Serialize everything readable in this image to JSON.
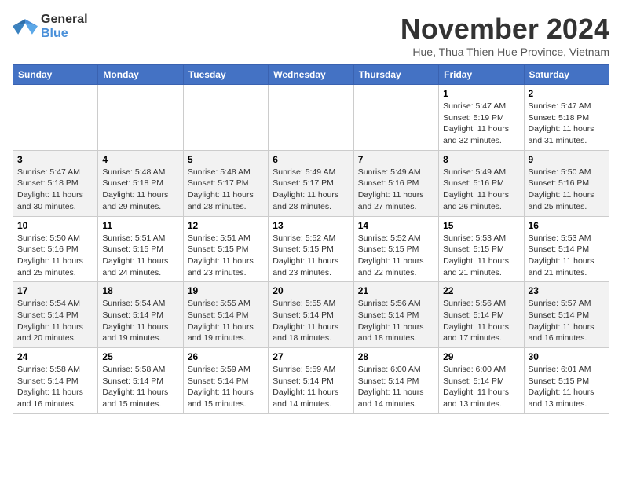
{
  "header": {
    "logo_line1": "General",
    "logo_line2": "Blue",
    "month_title": "November 2024",
    "location": "Hue, Thua Thien Hue Province, Vietnam"
  },
  "weekdays": [
    "Sunday",
    "Monday",
    "Tuesday",
    "Wednesday",
    "Thursday",
    "Friday",
    "Saturday"
  ],
  "weeks": [
    [
      {
        "day": "",
        "info": ""
      },
      {
        "day": "",
        "info": ""
      },
      {
        "day": "",
        "info": ""
      },
      {
        "day": "",
        "info": ""
      },
      {
        "day": "",
        "info": ""
      },
      {
        "day": "1",
        "info": "Sunrise: 5:47 AM\nSunset: 5:19 PM\nDaylight: 11 hours\nand 32 minutes."
      },
      {
        "day": "2",
        "info": "Sunrise: 5:47 AM\nSunset: 5:18 PM\nDaylight: 11 hours\nand 31 minutes."
      }
    ],
    [
      {
        "day": "3",
        "info": "Sunrise: 5:47 AM\nSunset: 5:18 PM\nDaylight: 11 hours\nand 30 minutes."
      },
      {
        "day": "4",
        "info": "Sunrise: 5:48 AM\nSunset: 5:18 PM\nDaylight: 11 hours\nand 29 minutes."
      },
      {
        "day": "5",
        "info": "Sunrise: 5:48 AM\nSunset: 5:17 PM\nDaylight: 11 hours\nand 28 minutes."
      },
      {
        "day": "6",
        "info": "Sunrise: 5:49 AM\nSunset: 5:17 PM\nDaylight: 11 hours\nand 28 minutes."
      },
      {
        "day": "7",
        "info": "Sunrise: 5:49 AM\nSunset: 5:16 PM\nDaylight: 11 hours\nand 27 minutes."
      },
      {
        "day": "8",
        "info": "Sunrise: 5:49 AM\nSunset: 5:16 PM\nDaylight: 11 hours\nand 26 minutes."
      },
      {
        "day": "9",
        "info": "Sunrise: 5:50 AM\nSunset: 5:16 PM\nDaylight: 11 hours\nand 25 minutes."
      }
    ],
    [
      {
        "day": "10",
        "info": "Sunrise: 5:50 AM\nSunset: 5:16 PM\nDaylight: 11 hours\nand 25 minutes."
      },
      {
        "day": "11",
        "info": "Sunrise: 5:51 AM\nSunset: 5:15 PM\nDaylight: 11 hours\nand 24 minutes."
      },
      {
        "day": "12",
        "info": "Sunrise: 5:51 AM\nSunset: 5:15 PM\nDaylight: 11 hours\nand 23 minutes."
      },
      {
        "day": "13",
        "info": "Sunrise: 5:52 AM\nSunset: 5:15 PM\nDaylight: 11 hours\nand 23 minutes."
      },
      {
        "day": "14",
        "info": "Sunrise: 5:52 AM\nSunset: 5:15 PM\nDaylight: 11 hours\nand 22 minutes."
      },
      {
        "day": "15",
        "info": "Sunrise: 5:53 AM\nSunset: 5:15 PM\nDaylight: 11 hours\nand 21 minutes."
      },
      {
        "day": "16",
        "info": "Sunrise: 5:53 AM\nSunset: 5:14 PM\nDaylight: 11 hours\nand 21 minutes."
      }
    ],
    [
      {
        "day": "17",
        "info": "Sunrise: 5:54 AM\nSunset: 5:14 PM\nDaylight: 11 hours\nand 20 minutes."
      },
      {
        "day": "18",
        "info": "Sunrise: 5:54 AM\nSunset: 5:14 PM\nDaylight: 11 hours\nand 19 minutes."
      },
      {
        "day": "19",
        "info": "Sunrise: 5:55 AM\nSunset: 5:14 PM\nDaylight: 11 hours\nand 19 minutes."
      },
      {
        "day": "20",
        "info": "Sunrise: 5:55 AM\nSunset: 5:14 PM\nDaylight: 11 hours\nand 18 minutes."
      },
      {
        "day": "21",
        "info": "Sunrise: 5:56 AM\nSunset: 5:14 PM\nDaylight: 11 hours\nand 18 minutes."
      },
      {
        "day": "22",
        "info": "Sunrise: 5:56 AM\nSunset: 5:14 PM\nDaylight: 11 hours\nand 17 minutes."
      },
      {
        "day": "23",
        "info": "Sunrise: 5:57 AM\nSunset: 5:14 PM\nDaylight: 11 hours\nand 16 minutes."
      }
    ],
    [
      {
        "day": "24",
        "info": "Sunrise: 5:58 AM\nSunset: 5:14 PM\nDaylight: 11 hours\nand 16 minutes."
      },
      {
        "day": "25",
        "info": "Sunrise: 5:58 AM\nSunset: 5:14 PM\nDaylight: 11 hours\nand 15 minutes."
      },
      {
        "day": "26",
        "info": "Sunrise: 5:59 AM\nSunset: 5:14 PM\nDaylight: 11 hours\nand 15 minutes."
      },
      {
        "day": "27",
        "info": "Sunrise: 5:59 AM\nSunset: 5:14 PM\nDaylight: 11 hours\nand 14 minutes."
      },
      {
        "day": "28",
        "info": "Sunrise: 6:00 AM\nSunset: 5:14 PM\nDaylight: 11 hours\nand 14 minutes."
      },
      {
        "day": "29",
        "info": "Sunrise: 6:00 AM\nSunset: 5:14 PM\nDaylight: 11 hours\nand 13 minutes."
      },
      {
        "day": "30",
        "info": "Sunrise: 6:01 AM\nSunset: 5:15 PM\nDaylight: 11 hours\nand 13 minutes."
      }
    ]
  ]
}
